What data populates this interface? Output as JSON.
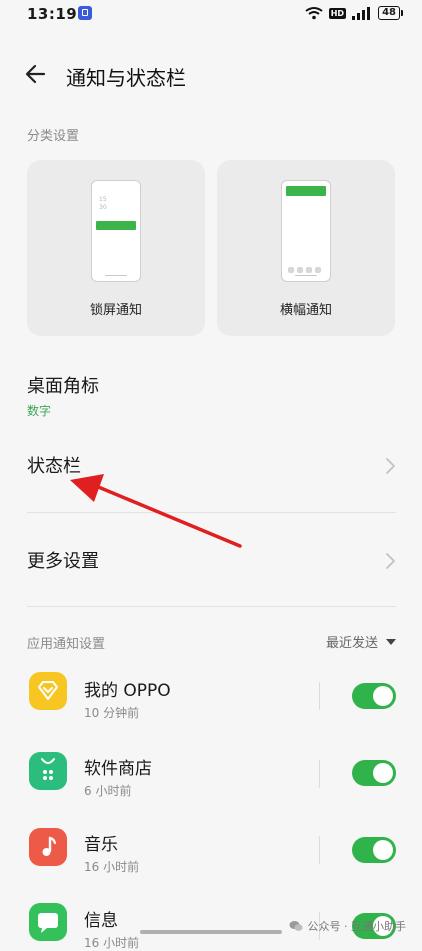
{
  "status_bar": {
    "time": "13:19",
    "hd": "HD",
    "battery": "48"
  },
  "header": {
    "title": "通知与状态栏"
  },
  "category": {
    "label": "分类设置",
    "cards": [
      {
        "label": "锁屏通知",
        "clock_line1": "15",
        "clock_line2": "30"
      },
      {
        "label": "横幅通知"
      }
    ]
  },
  "desktop_badge": {
    "title": "桌面角标",
    "value": "数字"
  },
  "status_bar_setting": {
    "title": "状态栏"
  },
  "more_settings": {
    "title": "更多设置"
  },
  "app_notifications": {
    "label": "应用通知设置",
    "sort": "最近发送",
    "apps": [
      {
        "name": "我的 OPPO",
        "time": "10 分钟前"
      },
      {
        "name": "软件商店",
        "time": "6 小时前"
      },
      {
        "name": "音乐",
        "time": "16 小时前"
      },
      {
        "name": "信息",
        "time": "16 小时前"
      }
    ]
  },
  "watermark": {
    "text": "公众号 · 互通小助手"
  },
  "colors": {
    "accent_green": "#2fb34a",
    "annotation_arrow": "#e02020"
  },
  "icons": [
    "back-arrow-icon",
    "chevron-right-icon",
    "caret-down-icon",
    "wifi-icon",
    "signal-icon",
    "battery-icon"
  ]
}
